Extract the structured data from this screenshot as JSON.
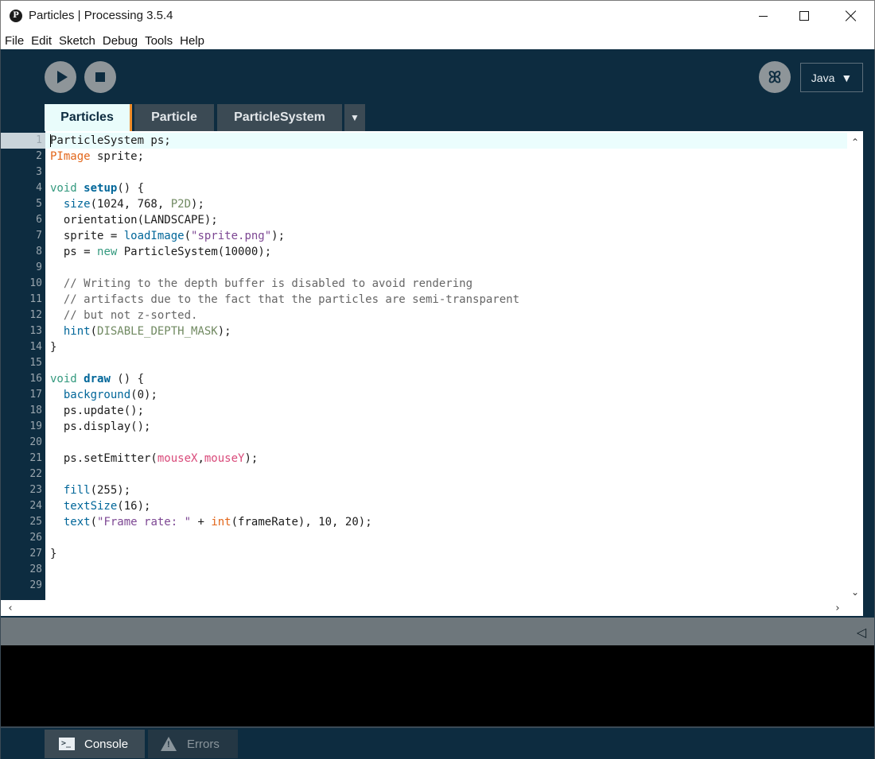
{
  "window": {
    "title": "Particles | Processing 3.5.4"
  },
  "menu": [
    "File",
    "Edit",
    "Sketch",
    "Debug",
    "Tools",
    "Help"
  ],
  "toolbar": {
    "mode": "Java"
  },
  "tabs": [
    "Particles",
    "Particle",
    "ParticleSystem"
  ],
  "editor": {
    "line_numbers": [
      "1",
      "2",
      "3",
      "4",
      "5",
      "6",
      "7",
      "8",
      "9",
      "10",
      "11",
      "12",
      "13",
      "14",
      "15",
      "16",
      "17",
      "18",
      "19",
      "20",
      "21",
      "22",
      "23",
      "24",
      "25",
      "26",
      "27",
      "28",
      "29"
    ],
    "lines": [
      "ParticleSystem ps;",
      "PImage sprite;",
      "",
      "void setup() {",
      "  size(1024, 768, P2D);",
      "  orientation(LANDSCAPE);",
      "  sprite = loadImage(\"sprite.png\");",
      "  ps = new ParticleSystem(10000);",
      "",
      "  // Writing to the depth buffer is disabled to avoid rendering",
      "  // artifacts due to the fact that the particles are semi-transparent",
      "  // but not z-sorted.",
      "  hint(DISABLE_DEPTH_MASK);",
      "}",
      "",
      "void draw () {",
      "  background(0);",
      "  ps.update();",
      "  ps.display();",
      "",
      "  ps.setEmitter(mouseX,mouseY);",
      "",
      "  fill(255);",
      "  textSize(16);",
      "  text(\"Frame rate: \" + int(frameRate), 10, 20);",
      "",
      "}",
      "",
      ""
    ]
  },
  "footer": {
    "console": "Console",
    "errors": "Errors"
  },
  "colors": {
    "background": "#0d2c40",
    "tab_active": "#e9fcfb",
    "tab_accent": "#f08c29"
  }
}
